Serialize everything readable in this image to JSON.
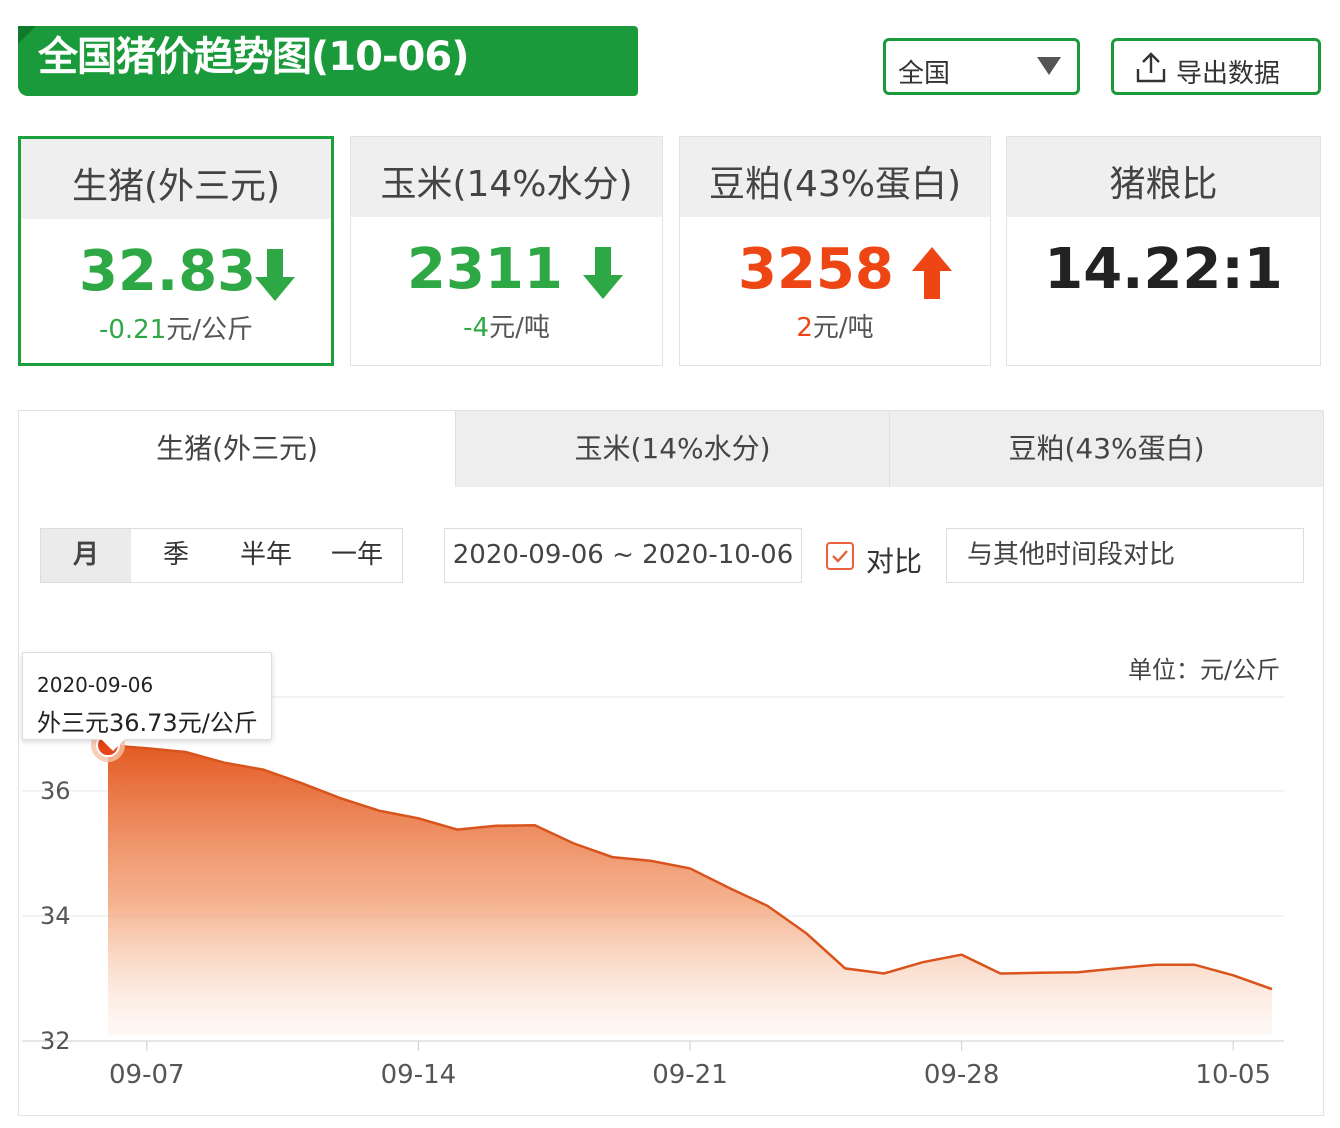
{
  "header": {
    "title": "全国猪价趋势图(10-06)",
    "region_select": "全国",
    "export_label": "导出数据"
  },
  "cards": [
    {
      "name": "生猪(外三元)",
      "value": "32.83",
      "trend": "down",
      "change_num": "-0.21",
      "change_unit": "元/公斤"
    },
    {
      "name": "玉米(14%水分)",
      "value": "2311",
      "trend": "down",
      "change_num": "-4",
      "change_unit": "元/吨"
    },
    {
      "name": "豆粕(43%蛋白)",
      "value": "3258",
      "trend": "up",
      "change_num": "2",
      "change_unit": "元/吨"
    },
    {
      "name": "猪粮比",
      "value": "14.22:1"
    }
  ],
  "tabs": [
    "生猪(外三元)",
    "玉米(14%水分)",
    "豆粕(43%蛋白)"
  ],
  "periods": [
    "月",
    "季",
    "半年",
    "一年"
  ],
  "date_range": "2020-09-06 ~ 2020-10-06",
  "compare": {
    "label": "对比",
    "placeholder": "与其他时间段对比",
    "checked": true
  },
  "tooltip": {
    "date": "2020-09-06",
    "text": "外三元36.73元/公斤"
  },
  "colors": {
    "brand_green": "#1a9a3a",
    "down_green": "#2ea845",
    "up_red": "#ee4514",
    "line": "#e0602a"
  },
  "chart_data": {
    "type": "area",
    "unit_label": "单位：元/公斤",
    "x": [
      "2020-09-06",
      "2020-09-07",
      "2020-09-08",
      "2020-09-09",
      "2020-09-10",
      "2020-09-11",
      "2020-09-12",
      "2020-09-13",
      "2020-09-14",
      "2020-09-15",
      "2020-09-16",
      "2020-09-17",
      "2020-09-18",
      "2020-09-19",
      "2020-09-20",
      "2020-09-21",
      "2020-09-22",
      "2020-09-23",
      "2020-09-24",
      "2020-09-25",
      "2020-09-26",
      "2020-09-27",
      "2020-09-28",
      "2020-09-29",
      "2020-09-30",
      "2020-10-01",
      "2020-10-02",
      "2020-10-03",
      "2020-10-04",
      "2020-10-05",
      "2020-10-06"
    ],
    "y": [
      36.73,
      36.68,
      36.62,
      36.45,
      36.34,
      36.12,
      35.88,
      35.68,
      35.56,
      35.38,
      35.44,
      35.45,
      35.16,
      34.94,
      34.88,
      34.76,
      34.45,
      34.16,
      33.72,
      33.16,
      33.08,
      33.26,
      33.38,
      33.08,
      33.09,
      33.1,
      33.16,
      33.22,
      33.22,
      33.05,
      32.83
    ],
    "xticks": [
      "09-07",
      "09-14",
      "09-21",
      "09-28",
      "10-05"
    ],
    "yticks": [
      32,
      34,
      36
    ],
    "ylim": [
      32,
      37.5
    ],
    "grid": true,
    "highlight_index": 0
  }
}
